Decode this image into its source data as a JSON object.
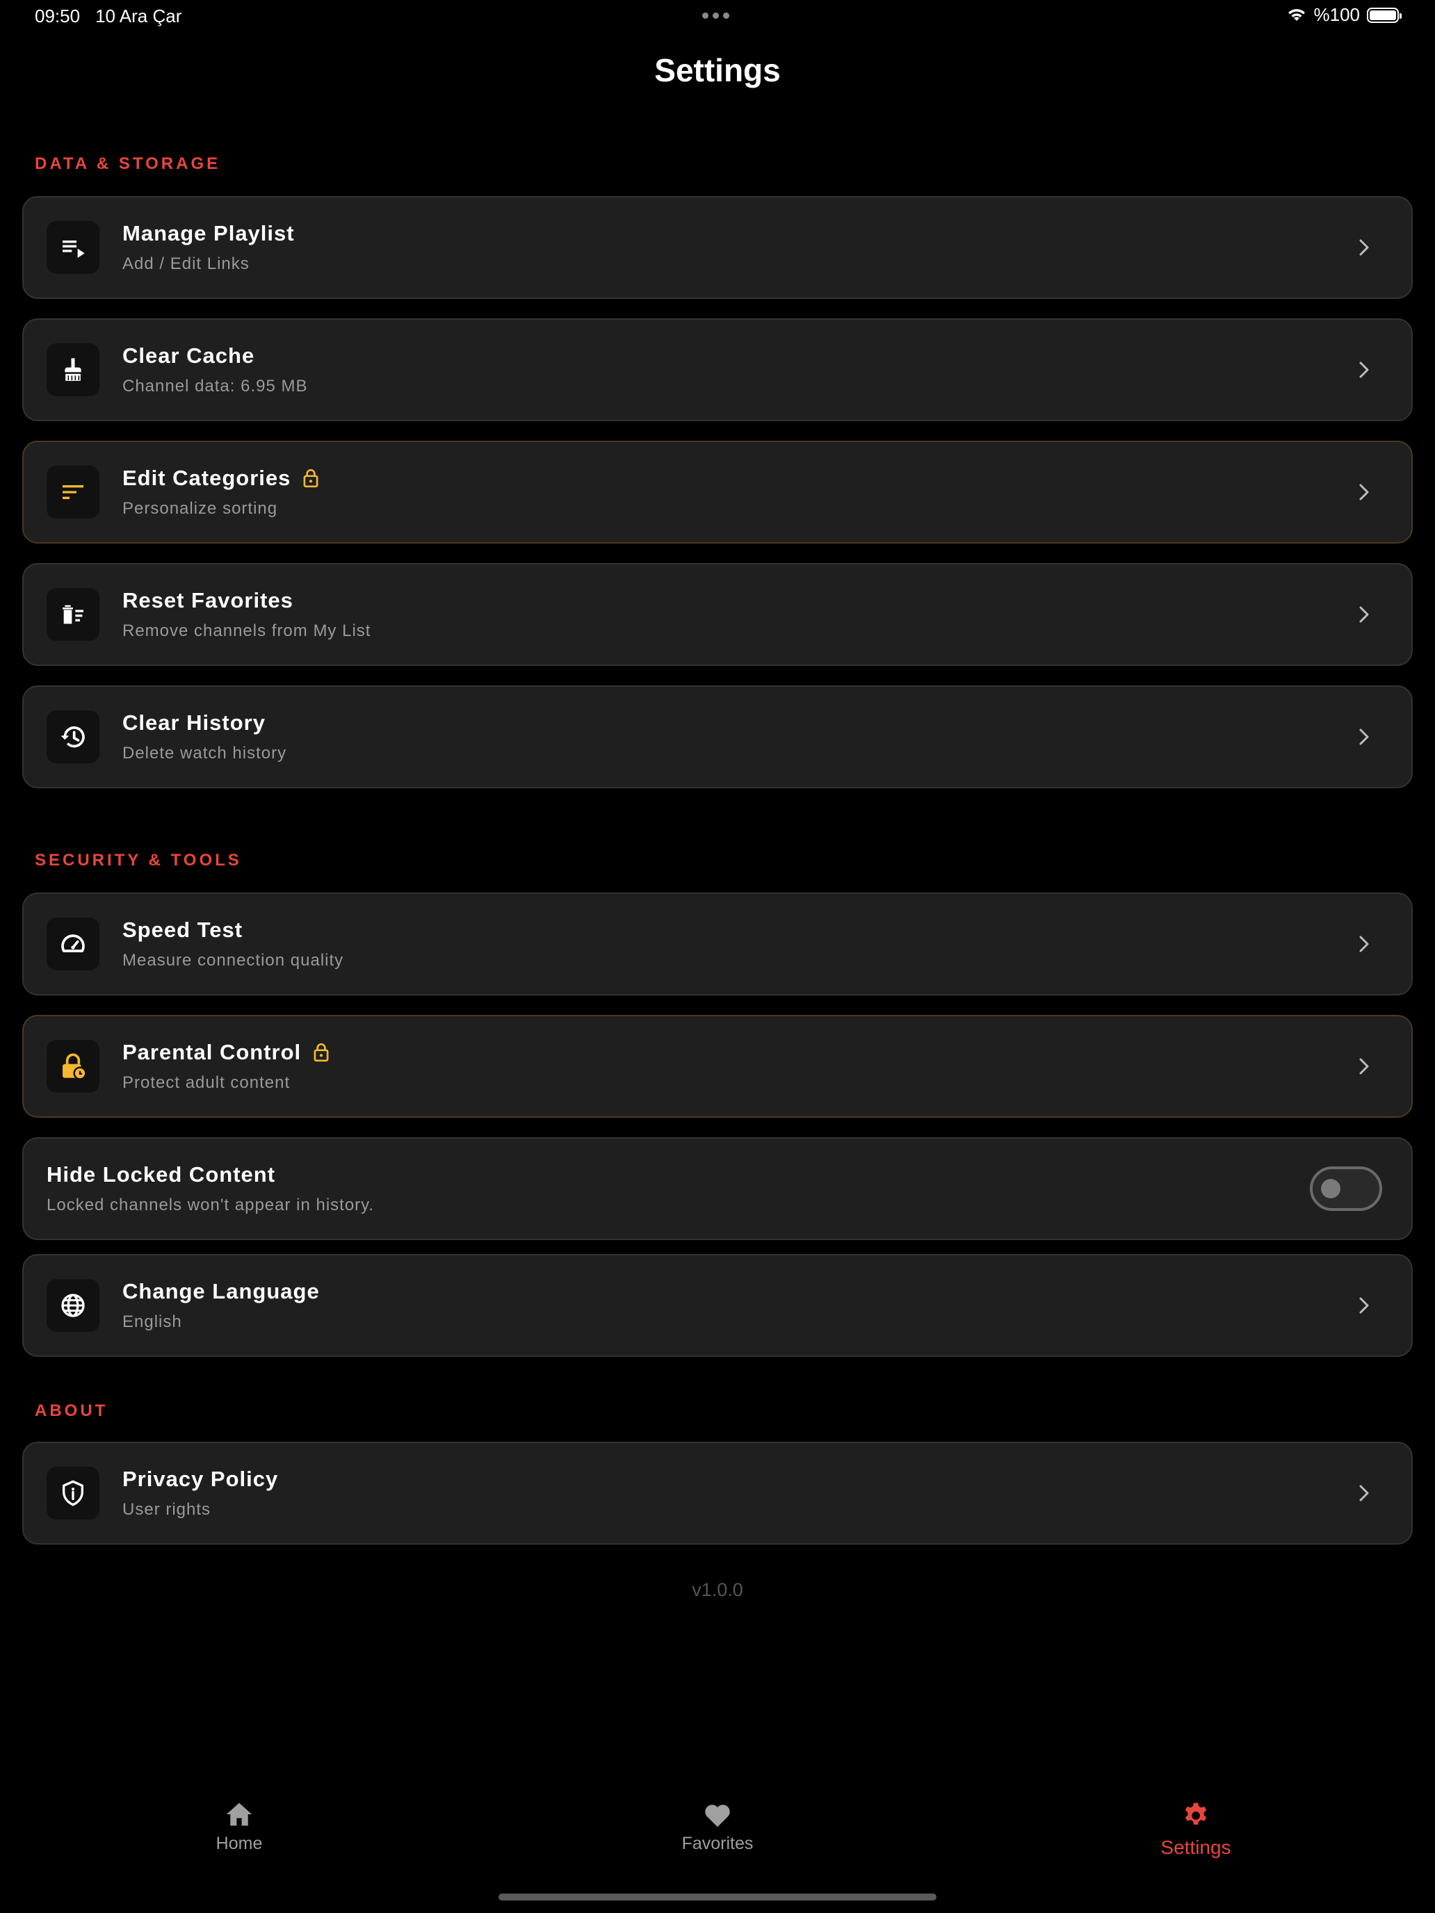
{
  "status_bar": {
    "time": "09:50",
    "date": "10 Ara Çar",
    "battery": "%100"
  },
  "header": {
    "title": "Settings"
  },
  "sections": {
    "data_storage": "DATA & STORAGE",
    "security_tools": "SECURITY & TOOLS",
    "about": "ABOUT"
  },
  "items": {
    "manage_playlist": {
      "title": "Manage Playlist",
      "subtitle": "Add / Edit Links",
      "icon": "playlist-play-icon"
    },
    "clear_cache": {
      "title": "Clear Cache",
      "subtitle": "Channel data: 6.95 MB",
      "icon": "broom-icon"
    },
    "edit_categories": {
      "title": "Edit Categories",
      "subtitle": "Personalize sorting",
      "icon": "sort-icon",
      "locked": true
    },
    "reset_favorites": {
      "title": "Reset Favorites",
      "subtitle": "Remove channels from My List",
      "icon": "delete-list-icon"
    },
    "clear_history": {
      "title": "Clear History",
      "subtitle": "Delete watch history",
      "icon": "history-icon"
    },
    "speed_test": {
      "title": "Speed Test",
      "subtitle": "Measure connection quality",
      "icon": "speedometer-icon"
    },
    "parental_control": {
      "title": "Parental Control",
      "subtitle": "Protect adult content",
      "icon": "lock-clock-icon",
      "locked": true
    },
    "hide_locked": {
      "title": "Hide Locked Content",
      "subtitle": "Locked channels won't appear in history.",
      "enabled": false
    },
    "change_language": {
      "title": "Change Language",
      "subtitle": "English",
      "icon": "globe-icon"
    },
    "privacy_policy": {
      "title": "Privacy Policy",
      "subtitle": "User rights",
      "icon": "shield-info-icon"
    }
  },
  "version": "v1.0.0",
  "tabs": {
    "home": "Home",
    "favorites": "Favorites",
    "settings": "Settings",
    "active": "settings"
  },
  "colors": {
    "accent": "#e8463d",
    "lock": "#f5b82e",
    "background": "#000000",
    "card": "#1f1f1f"
  }
}
